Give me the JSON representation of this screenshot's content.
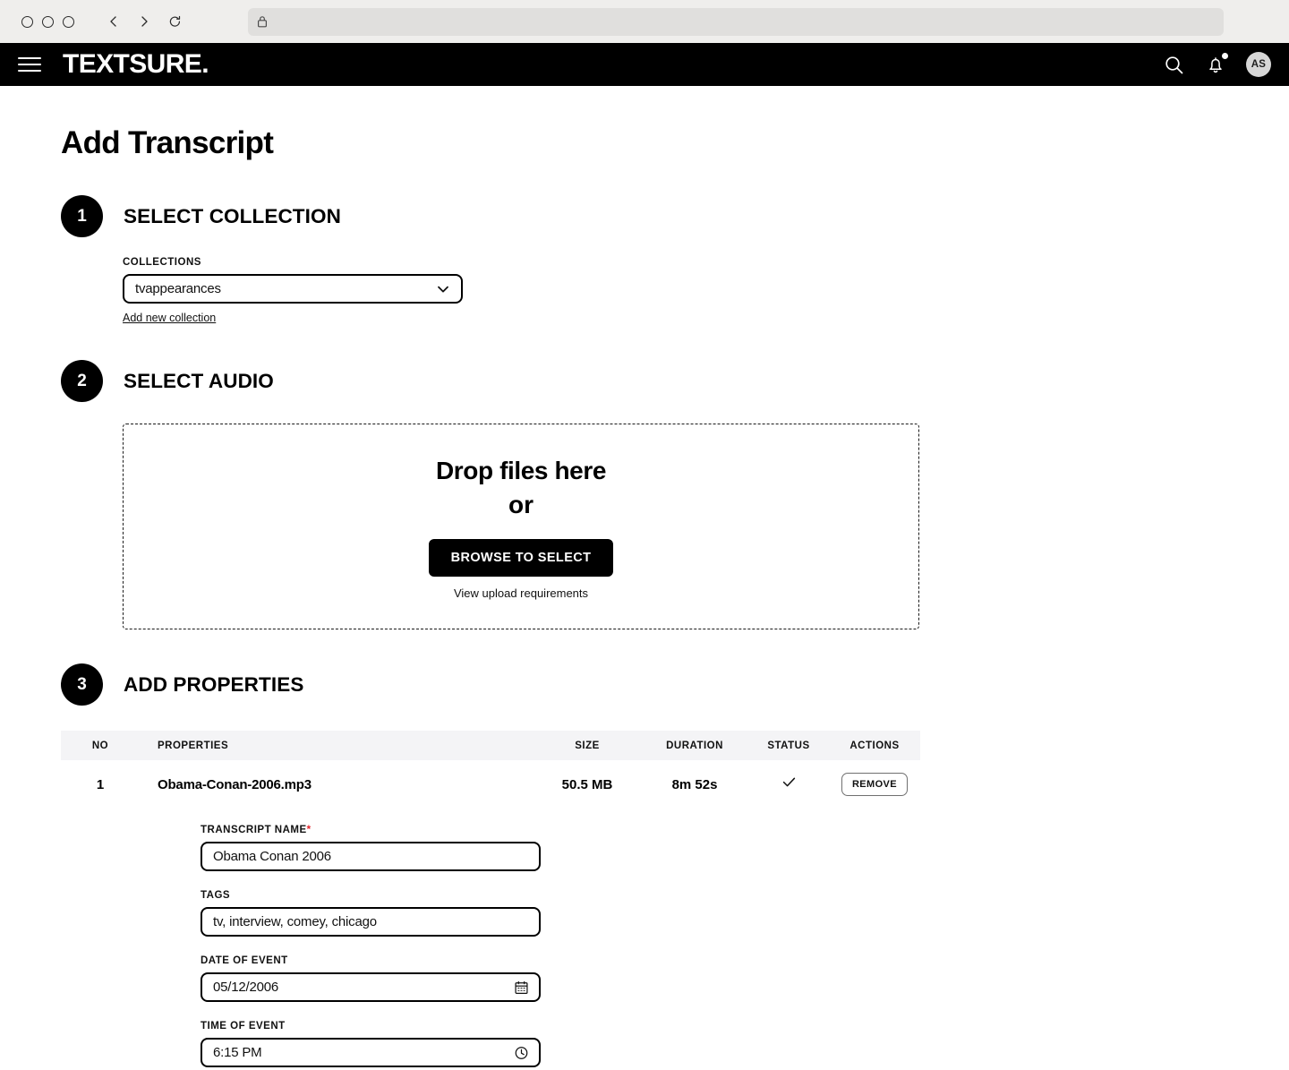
{
  "browser": {
    "window_dots": [
      "close",
      "minimize",
      "maximize"
    ],
    "back_icon": "chevron-left-icon",
    "forward_icon": "chevron-right-icon",
    "reload_icon": "reload-icon",
    "lock_icon": "lock-icon",
    "url": ""
  },
  "header": {
    "menu_icon": "hamburger-menu-icon",
    "brand": "TEXTSURE.",
    "search_icon": "search-icon",
    "bell_icon": "bell-icon",
    "avatar_initials": "AS"
  },
  "page": {
    "title": "Add Transcript"
  },
  "steps": [
    {
      "number": "1",
      "title": "SELECT COLLECTION"
    },
    {
      "number": "2",
      "title": "SELECT AUDIO"
    },
    {
      "number": "3",
      "title": "ADD PROPERTIES"
    }
  ],
  "collection": {
    "label": "COLLECTIONS",
    "value": "tvappearances",
    "options": [
      "tvappearances"
    ],
    "chevron_icon": "chevron-down-icon",
    "add_link": "Add new collection"
  },
  "dropzone": {
    "title": "Drop files here",
    "or": "or",
    "browse_button": "BROWSE TO SELECT",
    "requirements_link": "View upload requirements"
  },
  "table": {
    "columns": [
      "NO",
      "PROPERTIES",
      "SIZE",
      "DURATION",
      "STATUS",
      "ACTIONS"
    ],
    "rows": [
      {
        "no": "1",
        "properties": "Obama-Conan-2006.mp3",
        "size": "50.5 MB",
        "duration": "8m 52s",
        "status_icon": "check-icon",
        "action_label": "REMOVE"
      }
    ]
  },
  "form": {
    "transcript_name": {
      "label": "TRANSCRIPT NAME",
      "required_mark": "*",
      "value": "Obama Conan 2006"
    },
    "tags": {
      "label": "TAGS",
      "value": "tv, interview, comey, chicago"
    },
    "date_of_event": {
      "label": "DATE OF EVENT",
      "value": "05/12/2006",
      "icon": "calendar-icon"
    },
    "time_of_event": {
      "label": "TIME OF EVENT",
      "value": "6:15 PM",
      "icon": "clock-icon"
    }
  },
  "colors": {
    "brand_black": "#000000",
    "page_bg": "#ffffff",
    "table_header_bg": "#f4f4f6",
    "required_red": "#e3242b",
    "chrome_bg": "#efeeec"
  }
}
